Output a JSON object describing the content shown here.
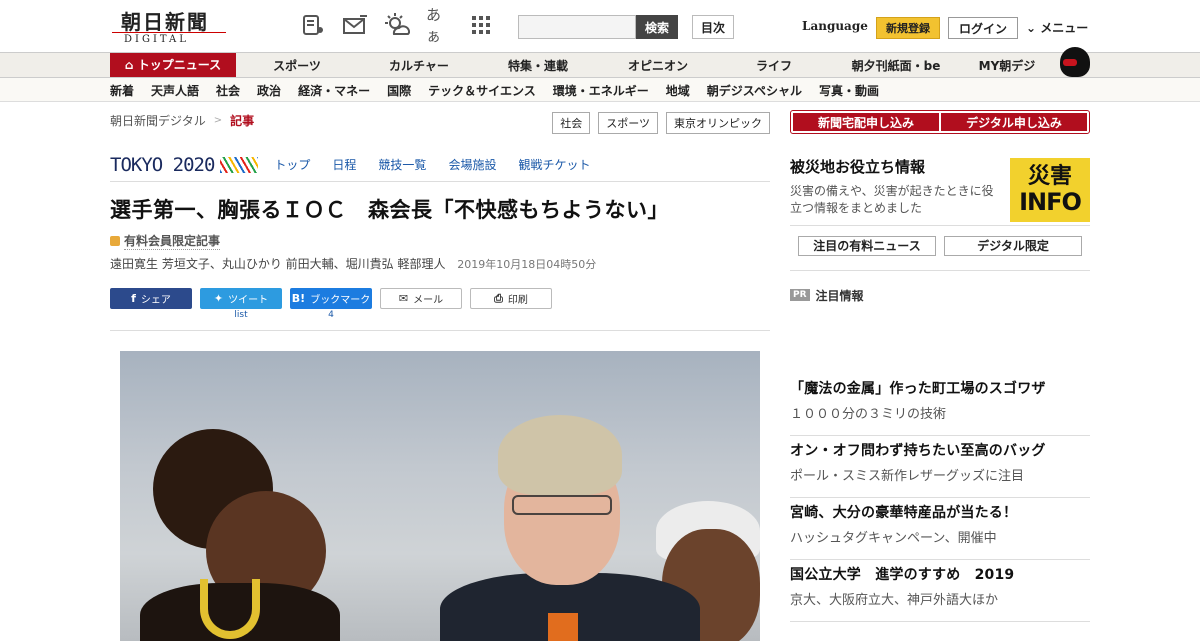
{
  "header": {
    "logo_jp": "朝日新聞",
    "logo_en": "DIGITAL",
    "icons": [
      "font-size-icon",
      "mail-icon",
      "weather-icon",
      "kana-icon",
      "grid-icon"
    ],
    "kana_label": "あぁ",
    "search_placeholder": "",
    "search_button": "検索",
    "toc_button": "目次",
    "language": "Language",
    "signup": "新規登録",
    "login": "ログイン",
    "menu": "メニュー"
  },
  "nav1": [
    "トップニュース",
    "スポーツ",
    "カルチャー",
    "特集・連載",
    "オピニオン",
    "ライフ",
    "朝夕刊紙面・be",
    "MY朝デジ"
  ],
  "nav2": [
    "新着",
    "天声人語",
    "社会",
    "政治",
    "経済・マネー",
    "国際",
    "テック＆サイエンス",
    "環境・エネルギー",
    "地域",
    "朝デジスペシャル",
    "写真・動画"
  ],
  "breadcrumb": {
    "home": "朝日新聞デジタル",
    "current": "記事"
  },
  "tags": [
    "社会",
    "スポーツ",
    "東京オリンピック"
  ],
  "olympic": {
    "logo": "TOKYO 2020",
    "links": [
      "トップ",
      "日程",
      "競技一覧",
      "会場施設",
      "観戦チケット"
    ]
  },
  "article": {
    "headline": "選手第一、胸張るＩＯＣ　森会長「不快感もちようない」",
    "member_badge": "有料会員限定記事",
    "authors": "遠田寛生 芳垣文子、丸山ひかり 前田大輔、堀川貴弘 軽部理人",
    "date": "2019年10月18日04時50分"
  },
  "share": {
    "facebook": "シェア",
    "twitter": "ツイート",
    "hatena": "ブックマーク",
    "mail": "メール",
    "print": "印刷",
    "twitter_count": "list",
    "hatena_count": "4"
  },
  "sidebar": {
    "subscribe_paper": "新聞宅配申し込み",
    "subscribe_digital": "デジタル申し込み",
    "disaster_title": "被災地お役立ち情報",
    "disaster_desc": "災害の備えや、災害が起きたときに役立つ情報をまとめました",
    "disaster_badge_top": "災害",
    "disaster_badge_bottom": "INFO",
    "link_paid_news": "注目の有料ニュース",
    "link_digital_only": "デジタル限定",
    "pr_label": "PR",
    "pr_heading": "注目情報",
    "pr_items": [
      {
        "title": "「魔法の金属」作った町工場のスゴワザ",
        "sub": "１０００分の３ミリの技術"
      },
      {
        "title": "オン・オフ問わず持ちたい至高のバッグ",
        "sub": "ポール・スミス新作レザーグッズに注目"
      },
      {
        "title": "宮崎、大分の豪華特産品が当たる！",
        "sub": "ハッシュタグキャンペーン、開催中"
      },
      {
        "title": "国公立大学　進学のすすめ　2019",
        "sub": "京大、大阪府立大、神戸外語大ほか"
      }
    ]
  }
}
